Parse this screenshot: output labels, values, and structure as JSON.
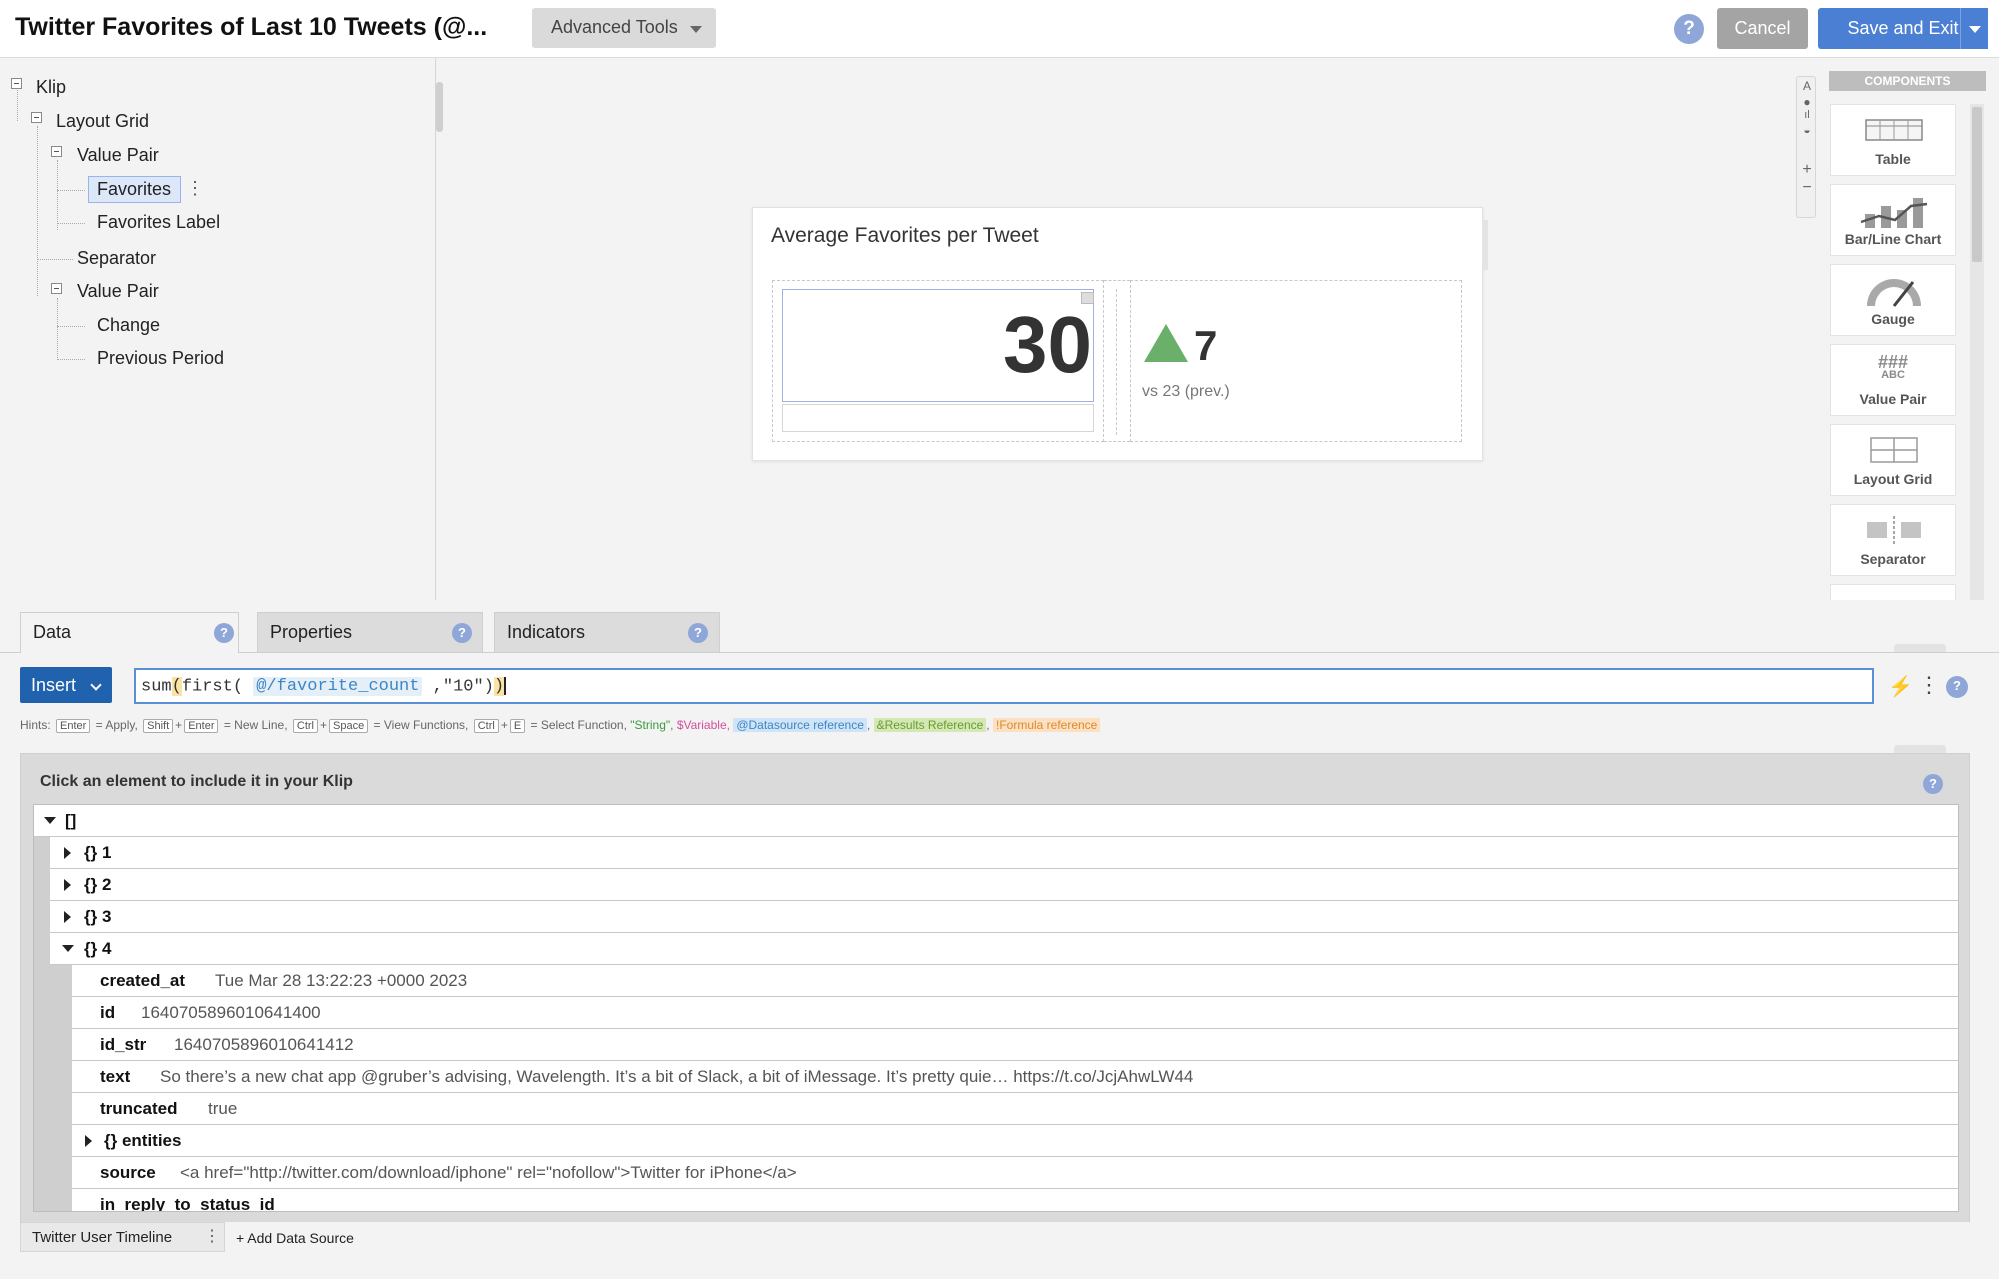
{
  "header": {
    "title": "Twitter Favorites of Last 10 Tweets (@...",
    "advanced_tools": "Advanced Tools",
    "help": "?",
    "cancel": "Cancel",
    "save_exit": "Save and Exit"
  },
  "tree": {
    "klip": "Klip",
    "layout_grid": "Layout Grid",
    "value_pair_1": "Value Pair",
    "favorites": "Favorites",
    "favorites_label": "Favorites Label",
    "separator": "Separator",
    "value_pair_2": "Value Pair",
    "change": "Change",
    "previous_period": "Previous Period"
  },
  "widget": {
    "title": "Average Favorites per Tweet",
    "value": "30",
    "change": "7",
    "previous": "vs 23 (prev.)",
    "up_color": "#6ab06a"
  },
  "zoom": {
    "a": "A",
    "plus": "+",
    "minus": "−"
  },
  "components": {
    "header": "COMPONENTS",
    "items": [
      "Table",
      "Bar/Line Chart",
      "Gauge",
      "Value Pair",
      "Layout Grid",
      "Separator"
    ],
    "value_pair_icon_top": "###",
    "value_pair_icon_bottom": "ABC"
  },
  "tabs": {
    "data": "Data",
    "properties": "Properties",
    "indicators": "Indicators",
    "help": "?"
  },
  "formula": {
    "insert": "Insert",
    "fn_sum": "sum",
    "open1": "(",
    "fn_first": "first",
    "open2": "(",
    "ds_ref": "@/favorite_count",
    "comma": ",",
    "arg": "\"10\"",
    "close1": ")",
    "close2": ")",
    "bolt": "⚡",
    "kebab": "⋮",
    "help": "?"
  },
  "hints": {
    "label": "Hints:",
    "enter": "Enter",
    "apply": "= Apply,",
    "shift": "Shift",
    "plus1": "+",
    "enter2": "Enter",
    "newline": "= New Line,",
    "ctrl": "Ctrl",
    "plus2": "+",
    "space": "Space",
    "view_functions": "= View Functions,",
    "ctrl2": "Ctrl",
    "plus3": "+",
    "e": "E",
    "select_function": "= Select Function,",
    "string": "\"String\",",
    "variable": "$Variable,",
    "datasource": "@Datasource reference",
    "comma1": ",",
    "results": "&Results Reference",
    "comma2": ",",
    "formula_ref": "!Formula reference"
  },
  "data_panel": {
    "title": "Click an element to include it in your Klip",
    "help": "?",
    "root": "[]",
    "objects": [
      "{} 1",
      "{} 2",
      "{} 3",
      "{} 4"
    ],
    "fields": [
      {
        "key": "created_at",
        "value": "Tue Mar 28 13:22:23 +0000 2023"
      },
      {
        "key": "id",
        "value": "1640705896010641400"
      },
      {
        "key": "id_str",
        "value": "1640705896010641412"
      },
      {
        "key": "text",
        "value": "So there’s a new chat app @gruber’s advising, Wavelength. It’s a bit of Slack, a bit of iMessage. It’s pretty quie… https://t.co/JcjAhwLW44"
      },
      {
        "key": "truncated",
        "value": "true"
      },
      {
        "key": "{} entities",
        "value": ""
      },
      {
        "key": "source",
        "value": "<a href=\"http://twitter.com/download/iphone\" rel=\"nofollow\">Twitter for iPhone</a>"
      },
      {
        "key": "in_reply_to_status_id",
        "value": ""
      }
    ]
  },
  "footer": {
    "source_tab": "Twitter User Timeline",
    "kebab": "⋮",
    "add_source": "+ Add Data Source"
  }
}
